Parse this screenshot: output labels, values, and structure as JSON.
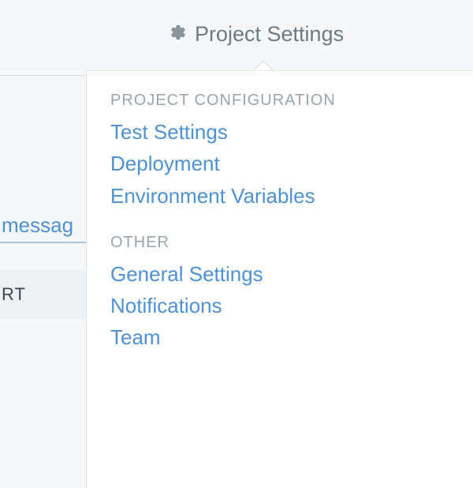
{
  "topbar": {
    "settings_label": "Project Settings"
  },
  "menu": {
    "sections": {
      "config": {
        "heading": "PROJECT CONFIGURATION",
        "items": {
          "test_settings": "Test Settings",
          "deployment": "Deployment",
          "env_vars": "Environment Variables"
        }
      },
      "other": {
        "heading": "OTHER",
        "items": {
          "general": "General Settings",
          "notifications": "Notifications",
          "team": "Team"
        }
      }
    }
  },
  "background": {
    "messag_fragment": "messag",
    "rt_fragment": "RT"
  },
  "colors": {
    "link": "#4f91d3",
    "muted": "#9aa5ae",
    "header_text": "#6e7b85"
  }
}
